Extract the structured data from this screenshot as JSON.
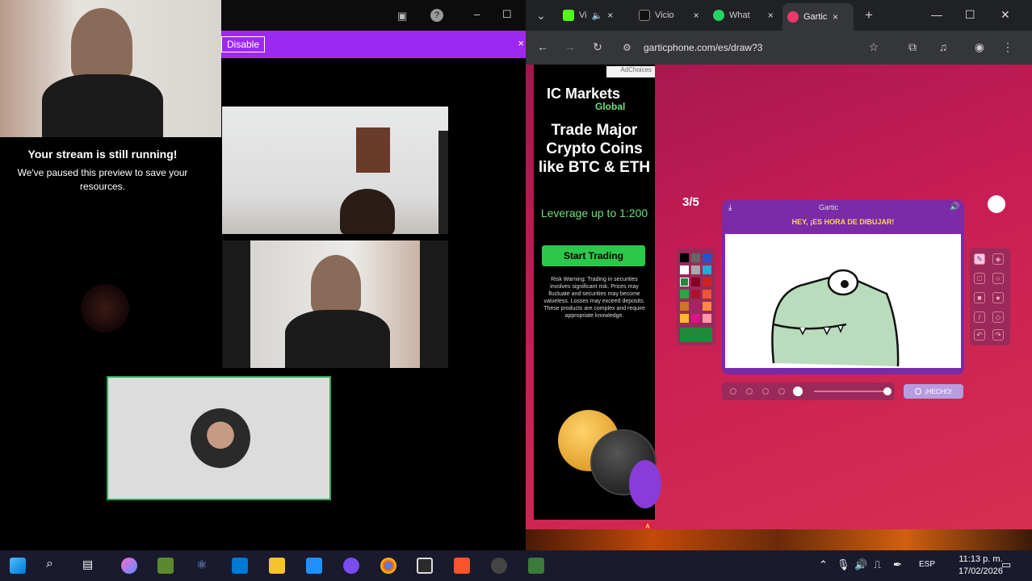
{
  "stream": {
    "disable_label": "Disable",
    "paused_title": "Your stream is still running!",
    "paused_body": "We've paused this preview to save your resources."
  },
  "browser": {
    "tabs": [
      {
        "label": "Vi",
        "icon": "kick-icon",
        "color": "#53fc18"
      },
      {
        "label": "Vicio",
        "icon": "tiktok-icon",
        "color": "#ffffff"
      },
      {
        "label": "What",
        "icon": "whatsapp-icon",
        "color": "#25d366"
      },
      {
        "label": "Gartic",
        "icon": "gartic-icon",
        "color": "#e83a6e"
      }
    ],
    "url": "garticphone.com/es/draw?3"
  },
  "ad": {
    "choices": "AdChoices",
    "brand": "IC Markets",
    "brand_sub": "Global",
    "headline": "Trade Major Crypto Coins like BTC & ETH",
    "leverage": "Leverage up to 1:200",
    "cta": "Start Trading",
    "warning": "Risk Warning: Trading in securities involves significant risk. Prices may fluctuate and securities may become valueless. Losses may exceed deposits. These products are complex and require appropriate knowledge."
  },
  "game": {
    "round": "3/5",
    "logo": "Gartic",
    "prompt": "HEY, ¡ES HORA DE DIBUJAR!",
    "done_label": "¡HECHO!",
    "palette": [
      "#000000",
      "#666666",
      "#2255cc",
      "#ffffff",
      "#aaaaaa",
      "#22aadd",
      "#1f8a3a",
      "#880022",
      "#cc2222",
      "#22aa44",
      "#aa1133",
      "#ee5533",
      "#cc7722",
      "#aa2266",
      "#ff8844",
      "#ffbb22",
      "#dd1188",
      "#ff99aa"
    ],
    "selected_color": "#1f8a3a"
  },
  "taskbar": {
    "lang": "ESP",
    "time": "11:13 p. m.",
    "date": "17/02/2026"
  }
}
